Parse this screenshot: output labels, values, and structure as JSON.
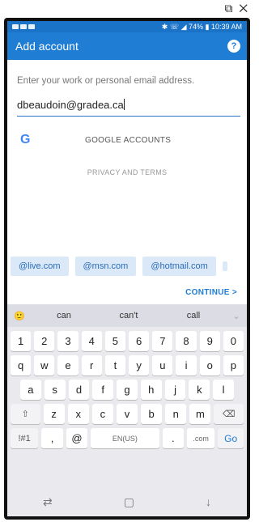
{
  "window_controls": {
    "snap": "⧉",
    "close": "✕"
  },
  "status_bar": {
    "right": "✱ ☏ ◢ 74% ▮ 10:39 AM"
  },
  "appbar": {
    "title": "Add account",
    "help": "?"
  },
  "prompt": "Enter your work or personal email address.",
  "email_value": "dbeaudoin@gradea.ca",
  "google": {
    "icon": "G",
    "label": "GOOGLE ACCOUNTS"
  },
  "privacy": "PRIVACY AND TERMS",
  "chips": [
    "@live.com",
    "@msn.com",
    "@hotmail.com"
  ],
  "continue": "CONTINUE >",
  "keyboard": {
    "suggestion_icon": "🙂",
    "suggestions": [
      "can",
      "can't",
      "call"
    ],
    "chevron": "⌄",
    "row1": [
      "1",
      "2",
      "3",
      "4",
      "5",
      "6",
      "7",
      "8",
      "9",
      "0"
    ],
    "row2": [
      "q",
      "w",
      "e",
      "r",
      "t",
      "y",
      "u",
      "i",
      "o",
      "p"
    ],
    "row3": [
      "a",
      "s",
      "d",
      "f",
      "g",
      "h",
      "j",
      "k",
      "l"
    ],
    "row4": [
      "⇧",
      "z",
      "x",
      "c",
      "v",
      "b",
      "n",
      "m",
      "⌫"
    ],
    "row5": [
      "!#1",
      ",",
      "@",
      "EN(US)",
      ".",
      ".com",
      "Go"
    ]
  },
  "navbar": {
    "recent": "⇄",
    "home": "▢",
    "back": "↓"
  }
}
